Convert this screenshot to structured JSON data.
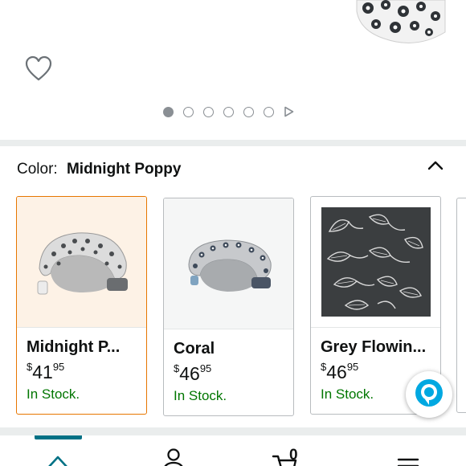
{
  "gallery": {
    "image_count": 6,
    "active_index": 0,
    "icons": [
      "heart-icon",
      "play-icon"
    ]
  },
  "variation": {
    "label": "Color:",
    "selected_value": "Midnight Poppy",
    "collapse_icon": "chevron-up-icon"
  },
  "swatches": [
    {
      "name": "Midnight P...",
      "currency": "$",
      "whole": "41",
      "fraction": "95",
      "stock": "In Stock.",
      "selected": true
    },
    {
      "name": "Coral",
      "currency": "$",
      "whole": "46",
      "fraction": "95",
      "stock": "In Stock.",
      "selected": false
    },
    {
      "name": "Grey Flowin...",
      "currency": "$",
      "whole": "46",
      "fraction": "95",
      "stock": "In Stock.",
      "selected": false
    }
  ],
  "assistant": {
    "icon": "alexa-icon"
  },
  "bottom_nav": {
    "items": [
      "home-icon",
      "account-icon",
      "cart-icon",
      "menu-icon"
    ],
    "active": "home-icon",
    "cart_count": "0"
  },
  "colors": {
    "accent_teal": "#007185",
    "selected_border": "#e77600",
    "in_stock": "#007600",
    "alexa_blue": "#00a8e1",
    "separator": "#eaeded"
  }
}
